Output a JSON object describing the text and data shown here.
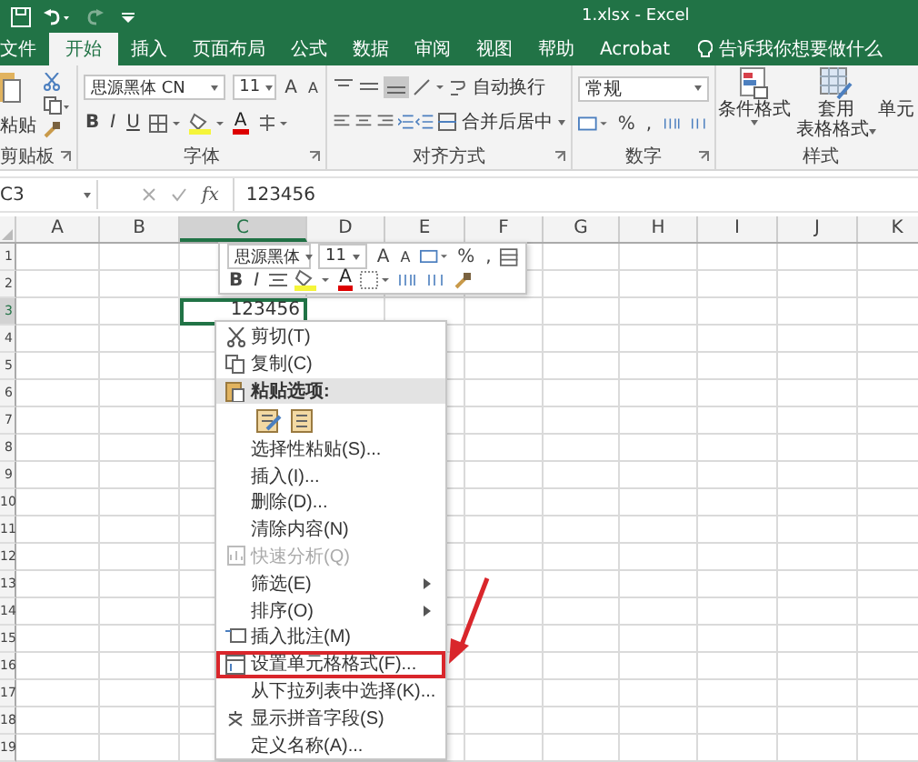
{
  "window": {
    "title": "1.xlsx  -  Excel"
  },
  "ribbon_tabs": [
    {
      "label": "文件",
      "selected": false
    },
    {
      "label": "开始",
      "selected": true
    },
    {
      "label": "插入",
      "selected": false
    },
    {
      "label": "页面布局",
      "selected": false
    },
    {
      "label": "公式",
      "selected": false
    },
    {
      "label": "数据",
      "selected": false
    },
    {
      "label": "审阅",
      "selected": false
    },
    {
      "label": "视图",
      "selected": false
    },
    {
      "label": "帮助",
      "selected": false
    },
    {
      "label": "Acrobat",
      "selected": false
    }
  ],
  "tell_me": "告诉我你想要做什么",
  "ribbon": {
    "clipboard": {
      "paste": "粘贴",
      "label": "剪贴板"
    },
    "font": {
      "name": "思源黑体 CN",
      "size": "11",
      "grow": "A",
      "shrink": "A",
      "bold": "B",
      "italic": "I",
      "underline": "U",
      "font_color": "A",
      "label": "字体"
    },
    "alignment": {
      "wrap": "自动换行",
      "merge": "合并后居中",
      "label": "对齐方式"
    },
    "number": {
      "format": "常规",
      "percent": "%",
      "comma": ",",
      "label": "数字"
    },
    "styles": {
      "conditional": "条件格式",
      "table_format": [
        "套用",
        "表格格式"
      ],
      "cell": "单元",
      "label": "样式"
    }
  },
  "formula_bar": {
    "name_box": "C3",
    "fx": "fx",
    "value": "123456"
  },
  "sheet": {
    "columns": [
      {
        "label": "A",
        "selected": false
      },
      {
        "label": "B",
        "selected": false
      },
      {
        "label": "C",
        "selected": true
      },
      {
        "label": "D",
        "selected": false
      },
      {
        "label": "E",
        "selected": false
      },
      {
        "label": "F",
        "selected": false
      },
      {
        "label": "G",
        "selected": false
      },
      {
        "label": "H",
        "selected": false
      },
      {
        "label": "I",
        "selected": false
      },
      {
        "label": "J",
        "selected": false
      },
      {
        "label": "K",
        "selected": false
      }
    ],
    "rows": [
      {
        "label": "1",
        "selected": false
      },
      {
        "label": "2",
        "selected": false
      },
      {
        "label": "3",
        "selected": true
      },
      {
        "label": "4",
        "selected": false
      },
      {
        "label": "5",
        "selected": false
      },
      {
        "label": "6",
        "selected": false
      },
      {
        "label": "7",
        "selected": false
      },
      {
        "label": "8",
        "selected": false
      },
      {
        "label": "9",
        "selected": false
      },
      {
        "label": "10",
        "selected": false
      },
      {
        "label": "11",
        "selected": false
      },
      {
        "label": "12",
        "selected": false
      },
      {
        "label": "13",
        "selected": false
      },
      {
        "label": "14",
        "selected": false
      },
      {
        "label": "15",
        "selected": false
      },
      {
        "label": "16",
        "selected": false
      },
      {
        "label": "17",
        "selected": false
      },
      {
        "label": "18",
        "selected": false
      },
      {
        "label": "19",
        "selected": false
      }
    ],
    "active_cell": {
      "value": "123456"
    }
  },
  "mini_toolbar": {
    "font": "思源黑体",
    "size": "11",
    "grow": "A",
    "shrink": "A",
    "percent": "%",
    "comma": ",",
    "bold": "B",
    "italic": "I",
    "font_color": "A"
  },
  "context_menu": [
    {
      "kind": "command",
      "label": "剪切(T)",
      "disabled": false,
      "submenu": false,
      "selected": false,
      "annotated": false
    },
    {
      "kind": "command",
      "label": "复制(C)",
      "disabled": false,
      "submenu": false,
      "selected": false,
      "annotated": false
    },
    {
      "kind": "heading",
      "label": "粘贴选项:",
      "disabled": false,
      "submenu": false,
      "selected": true,
      "annotated": false
    },
    {
      "kind": "paste_icons"
    },
    {
      "kind": "command",
      "label": "选择性粘贴(S)...",
      "disabled": false,
      "submenu": false,
      "selected": false,
      "annotated": false
    },
    {
      "kind": "command",
      "label": "插入(I)...",
      "disabled": false,
      "submenu": false,
      "selected": false,
      "annotated": false
    },
    {
      "kind": "command",
      "label": "删除(D)...",
      "disabled": false,
      "submenu": false,
      "selected": false,
      "annotated": false
    },
    {
      "kind": "command",
      "label": "清除内容(N)",
      "disabled": false,
      "submenu": false,
      "selected": false,
      "annotated": false
    },
    {
      "kind": "command",
      "label": "快速分析(Q)",
      "disabled": true,
      "submenu": false,
      "selected": false,
      "annotated": false
    },
    {
      "kind": "command",
      "label": "筛选(E)",
      "disabled": false,
      "submenu": true,
      "selected": false,
      "annotated": false
    },
    {
      "kind": "command",
      "label": "排序(O)",
      "disabled": false,
      "submenu": true,
      "selected": false,
      "annotated": false
    },
    {
      "kind": "command",
      "label": "插入批注(M)",
      "disabled": false,
      "submenu": false,
      "selected": false,
      "annotated": false
    },
    {
      "kind": "command",
      "label": "设置单元格格式(F)...",
      "disabled": false,
      "submenu": false,
      "selected": false,
      "annotated": true
    },
    {
      "kind": "command",
      "label": "从下拉列表中选择(K)...",
      "disabled": false,
      "submenu": false,
      "selected": false,
      "annotated": false
    },
    {
      "kind": "command",
      "label": "显示拼音字段(S)",
      "disabled": false,
      "submenu": false,
      "selected": false,
      "annotated": false
    },
    {
      "kind": "command",
      "label": "定义名称(A)...",
      "disabled": false,
      "submenu": false,
      "selected": false,
      "annotated": false
    }
  ]
}
